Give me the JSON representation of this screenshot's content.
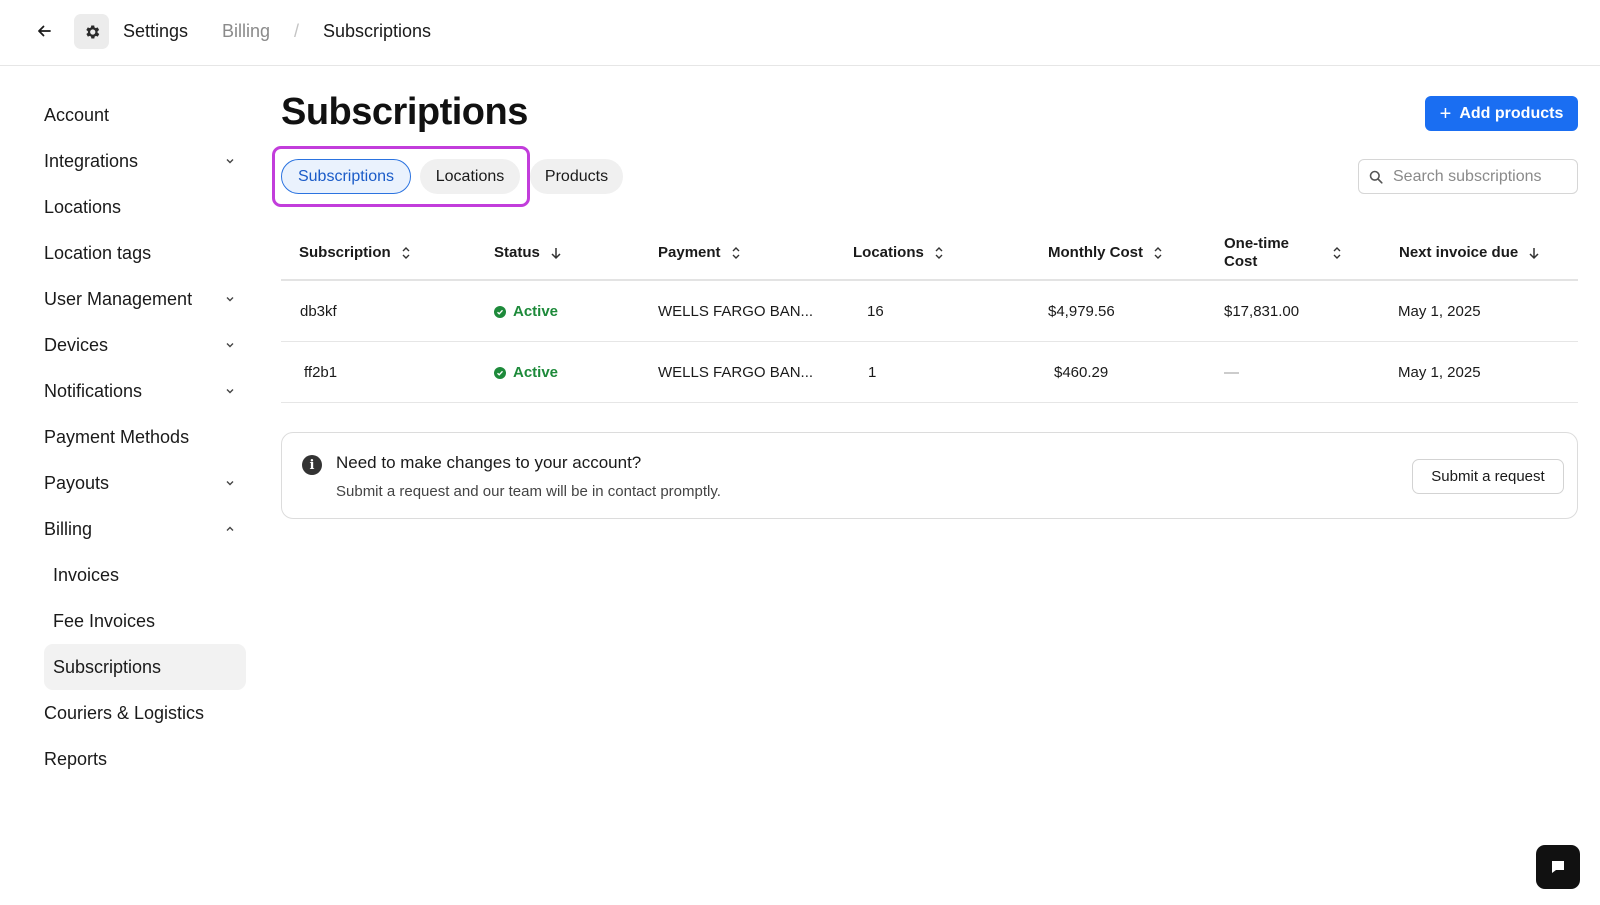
{
  "header": {
    "breadcrumb_settings": "Settings",
    "breadcrumb_billing": "Billing",
    "breadcrumb_separator": "/",
    "breadcrumb_current": "Subscriptions"
  },
  "sidebar": {
    "items": [
      {
        "label": "Account"
      },
      {
        "label": "Integrations"
      },
      {
        "label": "Locations"
      },
      {
        "label": "Location tags"
      },
      {
        "label": "User Management"
      },
      {
        "label": "Devices"
      },
      {
        "label": "Notifications"
      },
      {
        "label": "Payment Methods"
      },
      {
        "label": "Payouts"
      },
      {
        "label": "Billing"
      },
      {
        "label": "Invoices"
      },
      {
        "label": "Fee Invoices"
      },
      {
        "label": "Subscriptions"
      },
      {
        "label": "Couriers & Logistics"
      },
      {
        "label": "Reports"
      }
    ]
  },
  "main": {
    "title": "Subscriptions",
    "add_button_label": "Add products",
    "tabs": [
      {
        "label": "Subscriptions",
        "active": true
      },
      {
        "label": "Locations",
        "active": false
      },
      {
        "label": "Products",
        "active": false
      }
    ],
    "search": {
      "placeholder": "Search subscriptions",
      "value": ""
    }
  },
  "table": {
    "columns": [
      {
        "label": "Subscription",
        "sort": "both"
      },
      {
        "label": "Status",
        "sort": "down"
      },
      {
        "label": "Payment",
        "sort": "both"
      },
      {
        "label": "Locations",
        "sort": "both"
      },
      {
        "label": "Monthly Cost",
        "sort": "both"
      },
      {
        "label": "One-time Cost",
        "sort": "both"
      },
      {
        "label": "Next invoice due",
        "sort": "down"
      }
    ],
    "rows": [
      {
        "subscription": "db3kf",
        "status": "Active",
        "payment": "WELLS FARGO BAN...",
        "locations": "16",
        "monthly_cost": "$4,979.56",
        "onetime_cost": "$17,831.00",
        "next_invoice": "May 1, 2025"
      },
      {
        "subscription": "ff2b1",
        "status": "Active",
        "payment": "WELLS FARGO BAN...",
        "locations": "1",
        "monthly_cost": "$460.29",
        "onetime_cost": "—",
        "next_invoice": "May 1, 2025"
      }
    ]
  },
  "banner": {
    "title": "Need to make changes to your account?",
    "text": "Submit a request and our team will be in contact promptly.",
    "button_label": "Submit a request"
  },
  "colors": {
    "accent": "#1a6ef2",
    "active_status": "#1d8a3a",
    "highlight": "#c23ddb"
  }
}
